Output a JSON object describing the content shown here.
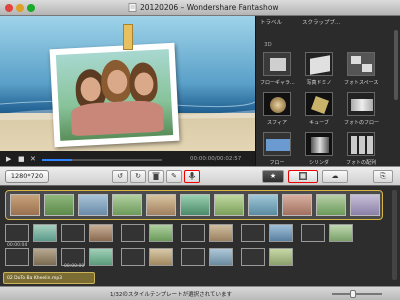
{
  "window": {
    "title": "20120206 – Wondershare Fantashow"
  },
  "right_panel": {
    "tabs": [
      "トラベル",
      "スクラップブ..."
    ],
    "section_label": "3D",
    "templates": [
      {
        "label": "フローギャラ..."
      },
      {
        "label": "写真ドミノ"
      },
      {
        "label": "フォトスペース"
      },
      {
        "label": "スフィア"
      },
      {
        "label": "キューブ"
      },
      {
        "label": "フォトのフロー"
      },
      {
        "label": "フロー"
      },
      {
        "label": "シリンダ"
      },
      {
        "label": "フォトの配列"
      }
    ]
  },
  "preview": {
    "timecode": "00:00:00/00:02:57",
    "progress": 0.25
  },
  "toolbar": {
    "resolution": "1280*720"
  },
  "storyboard": {
    "row2_time": "00:00:04",
    "audio_track": "02 DoTo Ba Kheelin.mp3",
    "audio_time": "00:00:00"
  },
  "status": {
    "message": "1/32のスタイルテンプレートが選択されています"
  },
  "icons": {
    "play": "play-icon",
    "stop": "stop-icon",
    "close": "close-icon",
    "star": "star-icon",
    "delete": "trash-icon"
  },
  "colors": {
    "highlight": "#e00000",
    "selection": "#d7b544",
    "progress": "#2f83ff"
  }
}
